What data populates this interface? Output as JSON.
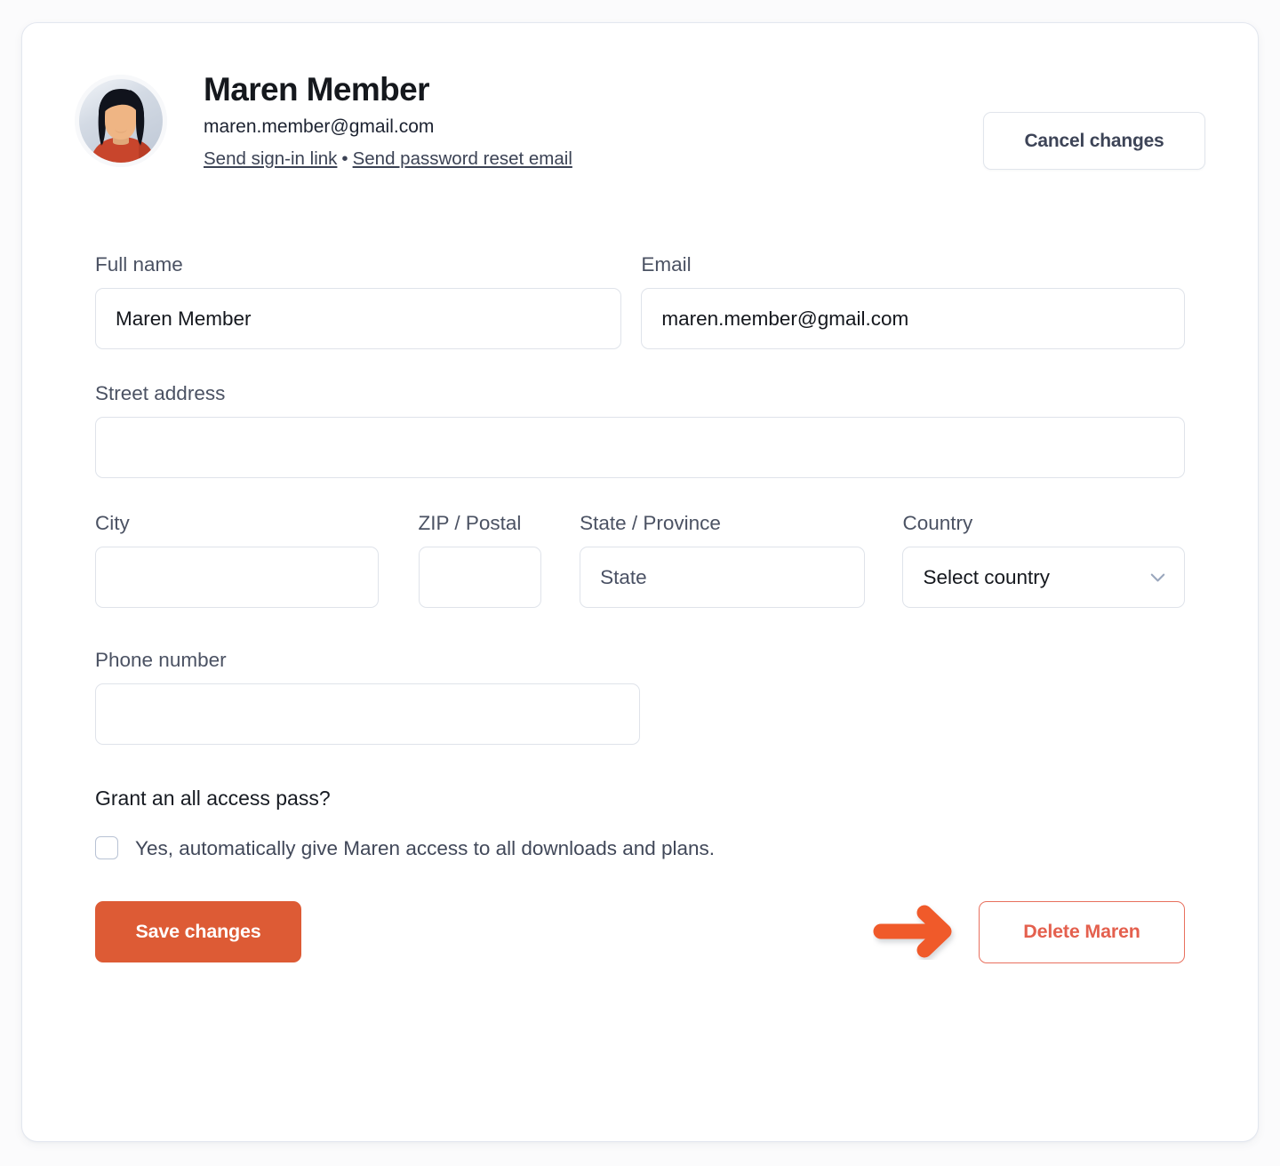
{
  "card": {
    "header": {
      "avatar_alt": "avatar-illustration",
      "name": "Maren Member",
      "email": "maren.member@gmail.com",
      "links": [
        {
          "label": "Send sign-in link"
        },
        {
          "label": "Send password reset email"
        }
      ],
      "link_separator": "•",
      "cancel_button": "Cancel changes"
    },
    "form": {
      "full_name": {
        "label": "Full name",
        "value": "Maren Member",
        "placeholder": ""
      },
      "email": {
        "label": "Email",
        "value": "maren.member@gmail.com",
        "placeholder": ""
      },
      "street_address": {
        "label": "Street address",
        "value": "",
        "placeholder": ""
      },
      "city": {
        "label": "City",
        "value": "",
        "placeholder": ""
      },
      "zip": {
        "label": "ZIP / Postal",
        "value": "",
        "placeholder": ""
      },
      "state": {
        "label": "State / Province",
        "value": "State",
        "placeholder": "State"
      },
      "country": {
        "label": "Country",
        "value": "Select country",
        "placeholder": "Select country",
        "chevron_icon": "chevron-down-icon"
      },
      "phone": {
        "label": "Phone number",
        "value": "",
        "placeholder": ""
      }
    },
    "grant": {
      "title": "Grant an all access pass?",
      "checkbox_label": "Yes, automatically give Maren access to all downloads and plans.",
      "checked": false
    },
    "actions": {
      "save_label": "Save changes",
      "delete_label": "Delete Maren",
      "annotation_icon": "right-arrow-icon"
    }
  },
  "colors": {
    "page_background": "#fbfbfc",
    "card_background": "#ffffff",
    "card_border": "#e3e7ef",
    "primary_accent": "#dd5b35",
    "danger_accent": "#e4604e",
    "annotation_arrow": "#f05a2b",
    "label_text": "#4b5263",
    "heading_text": "#15181d",
    "input_border": "#dfe3ea",
    "chevron": "#9aa7bd",
    "checkbox_border": "#b8c2d4"
  }
}
